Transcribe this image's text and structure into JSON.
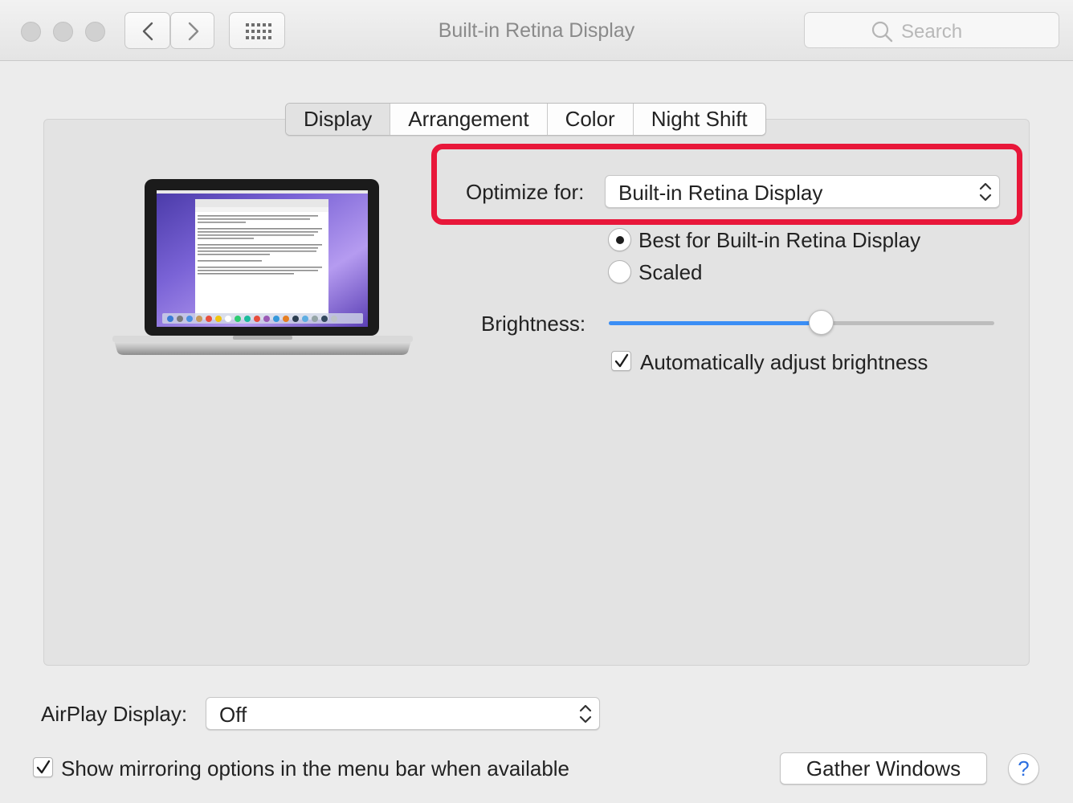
{
  "window": {
    "title": "Built-in Retina Display",
    "search_placeholder": "Search"
  },
  "tabs": [
    {
      "label": "Display",
      "active": true
    },
    {
      "label": "Arrangement",
      "active": false
    },
    {
      "label": "Color",
      "active": false
    },
    {
      "label": "Night Shift",
      "active": false
    }
  ],
  "display": {
    "optimize_label": "Optimize for:",
    "optimize_value": "Built-in Retina Display",
    "resolution_options": [
      {
        "label": "Best for Built-in Retina Display",
        "selected": true
      },
      {
        "label": "Scaled",
        "selected": false
      }
    ],
    "brightness_label": "Brightness:",
    "brightness_level": 0.55,
    "auto_brightness_label": "Automatically adjust brightness",
    "auto_brightness_checked": true
  },
  "footer": {
    "airplay_label": "AirPlay Display:",
    "airplay_value": "Off",
    "mirroring_label": "Show mirroring options in the menu bar when available",
    "mirroring_checked": true,
    "gather_button": "Gather Windows",
    "help_symbol": "?"
  },
  "colors": {
    "accent": "#3b8ef5",
    "highlight": "#e8173a"
  },
  "icons": [
    "back-chevron-icon",
    "forward-chevron-icon",
    "grid-icon",
    "search-icon",
    "updown-chevron-icon",
    "checkmark-icon",
    "laptop-illustration"
  ]
}
